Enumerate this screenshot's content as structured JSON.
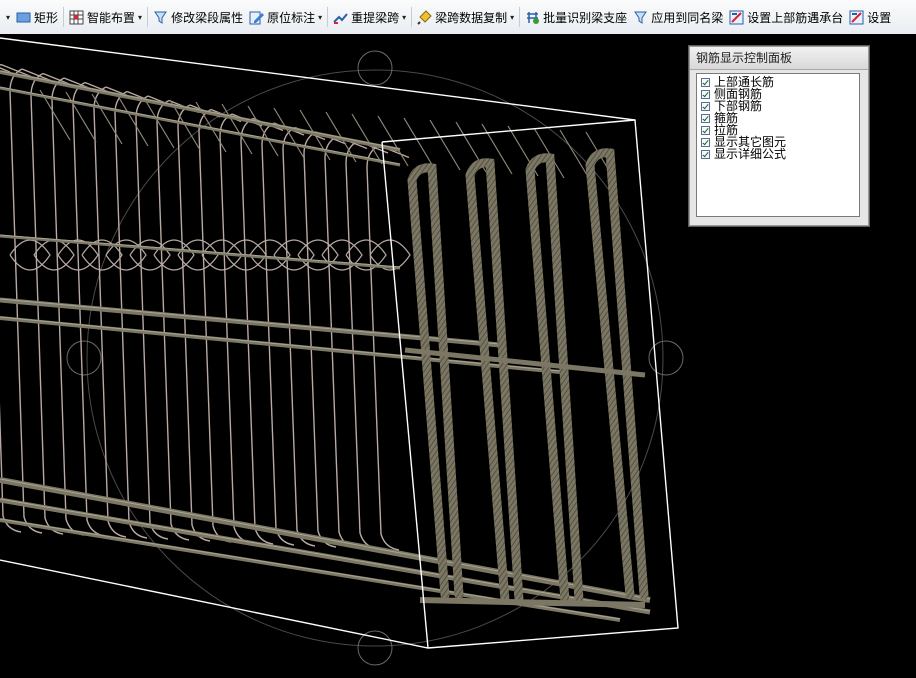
{
  "toolbar": {
    "items": [
      {
        "label": "矩形"
      },
      {
        "label": "智能布置"
      },
      {
        "label": "修改梁段属性"
      },
      {
        "label": "原位标注"
      },
      {
        "label": "重提梁跨"
      },
      {
        "label": "梁跨数据复制"
      },
      {
        "label": "批量识别梁支座"
      },
      {
        "label": "应用到同名梁"
      },
      {
        "label": "设置上部筋遇承台"
      },
      {
        "label": "设置"
      }
    ],
    "arrow_glyph": "▾"
  },
  "panel": {
    "title": "钢筋显示控制面板",
    "options": [
      {
        "label": "上部通长筋",
        "checked": true
      },
      {
        "label": "侧面钢筋",
        "checked": true
      },
      {
        "label": "下部钢筋",
        "checked": true
      },
      {
        "label": "箍筋",
        "checked": true
      },
      {
        "label": "拉筋",
        "checked": true
      },
      {
        "label": "显示其它图元",
        "checked": true
      },
      {
        "label": "显示详细公式",
        "checked": true
      }
    ]
  },
  "colors": {
    "rebar_main": "#7b7764",
    "rebar_dark": "#46442f",
    "rebar_light": "#a8a593",
    "stirrup_thin": "#b9a9a3",
    "box_outline": "#ffffff",
    "background": "#000000"
  }
}
